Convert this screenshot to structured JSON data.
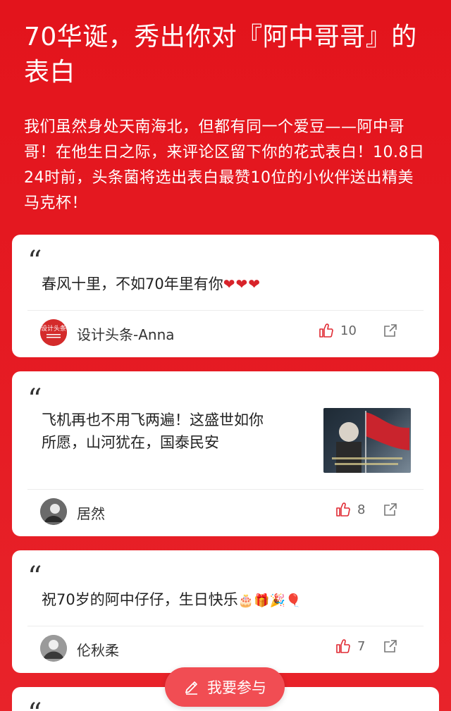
{
  "header": {
    "title": "70华诞，秀出你对『阿中哥哥』的表白",
    "intro": "我们虽然身处天南海北，但都有同一个爱豆——阿中哥哥！在他生日之际，来评论区留下你的花式表白！10.8日24时前，头条菌将选出表白最赞10位的小伙伴送出精美马克杯！"
  },
  "comments": [
    {
      "quote": "“",
      "text": "春风十里，不如70年里有你",
      "trailing": "❤❤❤",
      "author": "设计头条-Anna",
      "avatar_label": "设计头条",
      "likes": "10",
      "icons": [
        "like-icon",
        "share-icon"
      ]
    },
    {
      "quote": "“",
      "text": "飞机再也不用飞两遍！这盛世如你所愿，山河犹在，国泰民安",
      "author": "居然",
      "likes": "8",
      "icons": [
        "like-icon",
        "share-icon"
      ]
    },
    {
      "quote": "“",
      "text": "祝70岁的阿中仔仔，生日快乐",
      "trailing": "🎂🎁🎉🎈",
      "author": "伦秋柔",
      "likes": "7",
      "icons": [
        "like-icon",
        "share-icon"
      ]
    },
    {
      "quote": "“"
    }
  ],
  "fab": {
    "label": "我要参与",
    "icon": "pencil-icon"
  },
  "colors": {
    "background": "#e3141c",
    "fab": "#f14d53",
    "heart": "#d8232a"
  }
}
